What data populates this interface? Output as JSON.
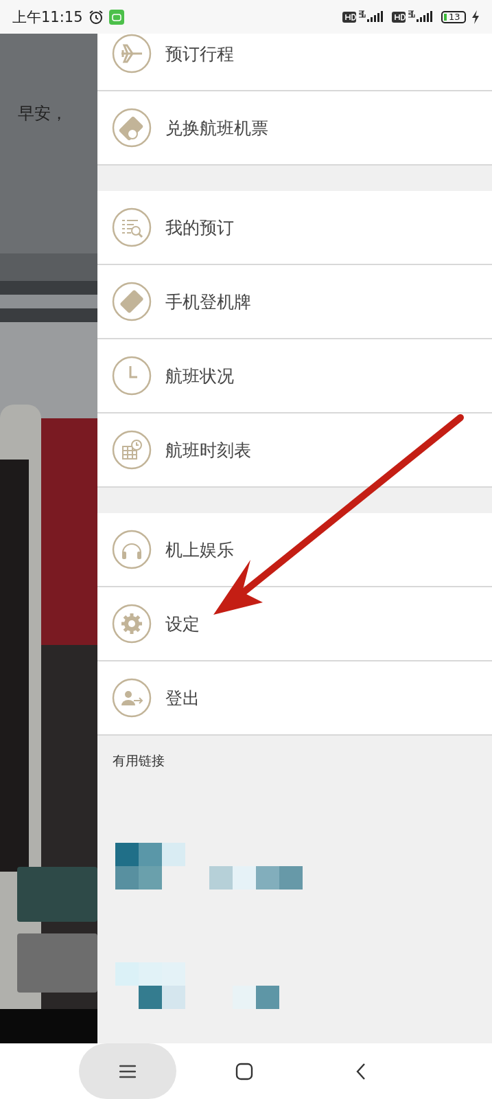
{
  "status_bar": {
    "time": "上午11:15",
    "battery": "13"
  },
  "background": {
    "greeting": "早安，"
  },
  "menu_groups": [
    [
      {
        "label": "预订行程",
        "kind": "plane"
      },
      {
        "label": "兑换航班机票",
        "kind": "ticket-award"
      }
    ],
    [
      {
        "label": "我的预订",
        "kind": "list-search"
      },
      {
        "label": "手机登机牌",
        "kind": "ticket"
      },
      {
        "label": "航班状况",
        "kind": "clock"
      },
      {
        "label": "航班时刻表",
        "kind": "calendar-clock"
      }
    ],
    [
      {
        "label": "机上娱乐",
        "kind": "headphones"
      },
      {
        "label": "设定",
        "kind": "gear"
      },
      {
        "label": "登出",
        "kind": "logout"
      }
    ]
  ],
  "links": {
    "title": "有用链接"
  },
  "nav_bar": {
    "buttons": [
      {
        "kind": "menu",
        "selected": true
      },
      {
        "kind": "home",
        "selected": false
      },
      {
        "kind": "back",
        "selected": false
      }
    ]
  }
}
